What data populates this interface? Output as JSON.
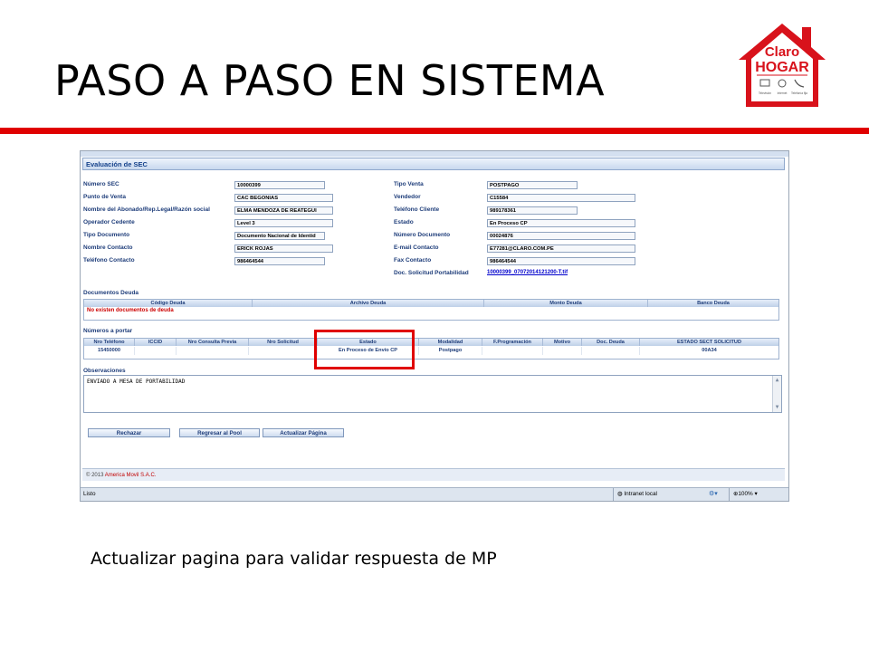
{
  "slide": {
    "title": "PASO A PASO EN SISTEMA",
    "caption": "Actualizar pagina para validar respuesta de MP",
    "logo": {
      "line1": "Claro",
      "line2": "HOGAR",
      "sub": [
        "Televisión",
        "Internet",
        "Telefonía fija"
      ]
    }
  },
  "colors": {
    "accent": "#e00000",
    "panel_text": "#1e3d7a"
  },
  "panel": {
    "title": "Evaluación de SEC"
  },
  "left_fields": [
    {
      "label": "Número SEC",
      "value": "10000399"
    },
    {
      "label": "Punto de Venta",
      "value": "CAC BEGONIAS"
    },
    {
      "label": "Nombre del Abonado/Rep.Legal/Razón social",
      "value": "ELMA MENDOZA DE REATEGUI"
    },
    {
      "label": "Operador Cedente",
      "value": "Level 3"
    },
    {
      "label": "Tipo Documento",
      "value": "Documento Nacional de Identid"
    },
    {
      "label": "Nombre Contacto",
      "value": "ERICK ROJAS"
    },
    {
      "label": "Teléfono Contacto",
      "value": "986464544"
    }
  ],
  "right_fields": [
    {
      "label": "Tipo Venta",
      "value": "POSTPAGO"
    },
    {
      "label": "Vendedor",
      "value": "C15584"
    },
    {
      "label": "Teléfono Cliente",
      "value": "989178361"
    },
    {
      "label": "Estado",
      "value": "En Proceso CP"
    },
    {
      "label": "Número Documento",
      "value": "00024876"
    },
    {
      "label": "E-mail Contacto",
      "value": "E77281@CLARO.COM.PE"
    },
    {
      "label": "Fax Contacto",
      "value": "986464544"
    }
  ],
  "doc_solicitud": {
    "label": "Doc. Solicitud Portabilidad",
    "link": "10000399_07072014121200-T.tif"
  },
  "documentos_deuda": {
    "title": "Documentos Deuda",
    "headers": [
      "Código Deuda",
      "Archivo Deuda",
      "Monto Deuda",
      "Banco Deuda"
    ],
    "empty": "No existen documentos de deuda"
  },
  "numeros": {
    "title": "Números a portar",
    "headers": [
      "Nro Teléfono",
      "ICCID",
      "Nro Consulta Previa",
      "Nro Solicitud",
      "Estado",
      "Modalidad",
      "F.Programación",
      "Motivo",
      "Doc. Deuda",
      "ESTADO SECT SOLICITUD"
    ],
    "row": [
      "15450000",
      "",
      "",
      "",
      "En Proceso de Envío CP",
      "Postpago",
      "",
      "",
      "",
      "00A34"
    ]
  },
  "observaciones": {
    "title": "Observaciones",
    "value": "ENVIADO A MESA DE PORTABILIDAD"
  },
  "buttons": {
    "rechazar": "Rechazar",
    "regresar": "Regresar al Pool",
    "actualizar": "Actualizar Página"
  },
  "footer": {
    "copy": "© 2013",
    "company": "America Movil S.A.C."
  },
  "statusbar": {
    "left": "Listo",
    "zone": "Intranet local",
    "zoom": "100%"
  }
}
